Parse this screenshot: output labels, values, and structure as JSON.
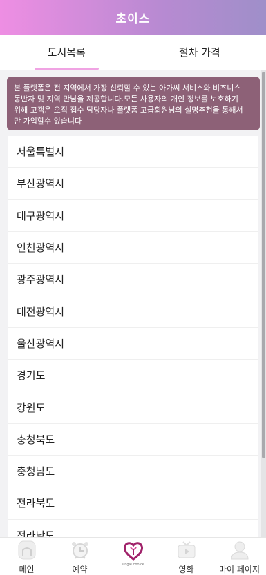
{
  "header": {
    "title": "초이스"
  },
  "tabs": [
    {
      "label": "도시목록",
      "active": true
    },
    {
      "label": "절차 가격",
      "active": false
    }
  ],
  "notice": {
    "lines": [
      "본 플랫폼은 전 지역에서 가장 신뢰할 수 있는 아가씨 서비스와 비즈니스",
      "동반자 및 지역 만남을 제공합니다.모든 사용자의 개인 정보를 보호하기",
      "위해 고객은 오직 접수 담당자나 플랫폼 고급회원님의 실명추천을 통해서",
      "만 가입할수 있습니다"
    ]
  },
  "cities": [
    "서울특별시",
    "부산광역시",
    "대구광역시",
    "인천광역시",
    "광주광역시",
    "대전광역시",
    "울산광역시",
    "경기도",
    "강원도",
    "충청북도",
    "충청남도",
    "전라북도",
    "전라남도"
  ],
  "bottom_nav": [
    {
      "label": "메인",
      "icon": "home-icon"
    },
    {
      "label": "예약",
      "icon": "alarm-clock-icon"
    },
    {
      "label": "",
      "icon": "brand-heart-logo",
      "logo_text": "single choice"
    },
    {
      "label": "영화",
      "icon": "tv-icon"
    },
    {
      "label": "마이 페이지",
      "icon": "user-icon"
    }
  ],
  "colors": {
    "header_gradient_start": "#ee8ee3",
    "header_gradient_end": "#9f8fc9",
    "tab_indicator": "#f0a3e3",
    "notice_bg": "#8d6177",
    "logo_accent": "#a0226a"
  }
}
